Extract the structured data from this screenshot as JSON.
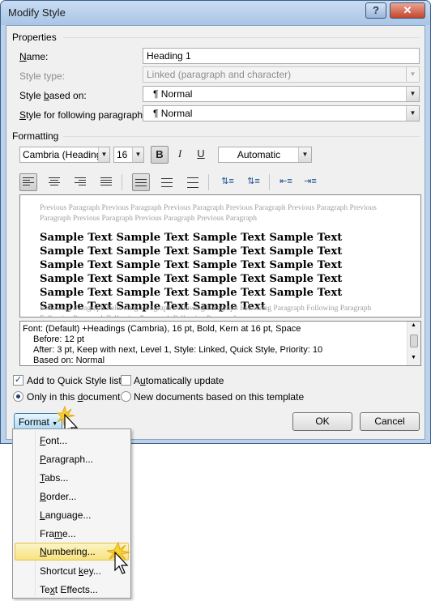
{
  "window": {
    "title": "Modify Style",
    "help_symbol": "?",
    "close_symbol": "x"
  },
  "properties": {
    "section_label": "Properties",
    "name_label": "Name:",
    "name_value": "Heading 1",
    "style_type_label": "Style type:",
    "style_type_value": "Linked (paragraph and character)",
    "based_on_label": "Style based on:",
    "based_on_value": "¶  Normal",
    "following_label": "Style for following paragraph:",
    "following_value": "¶  Normal"
  },
  "formatting": {
    "section_label": "Formatting",
    "font_name": "Cambria (Headings)",
    "font_size": "16",
    "bold_label": "B",
    "italic_label": "I",
    "underline_label": "U",
    "color_value": "Automatic"
  },
  "preview": {
    "previous_paragraph": "Previous Paragraph Previous Paragraph Previous Paragraph Previous Paragraph Previous Paragraph Previous Paragraph Previous Paragraph Previous Paragraph Previous Paragraph",
    "sample_text": "Sample Text Sample Text Sample Text Sample Text Sample Text Sample Text Sample Text Sample Text Sample Text Sample Text Sample Text Sample Text Sample Text Sample Text Sample Text Sample Text Sample Text Sample Text Sample Text Sample Text Sample Text Sample Text Sample Text",
    "following_paragraph": "Following Paragraph Following Paragraph Following Paragraph Following Paragraph Following Paragraph Following Paragraph Following Paragraph Following Paragraph"
  },
  "description": {
    "line1": "Font: (Default) +Headings (Cambria), 16 pt, Bold, Kern at 16 pt, Space",
    "line2": "Before:  12 pt",
    "line3": "After:  3 pt, Keep with next, Level 1, Style: Linked, Quick Style, Priority: 10",
    "line4": "Based on: Normal"
  },
  "options": {
    "quick_style_label": "Add to Quick Style list",
    "quick_style_checked": true,
    "auto_update_label": "Automatically update",
    "auto_update_checked": false,
    "only_doc_label": "Only in this document",
    "new_docs_label": "New documents based on this template",
    "selected_scope": "only_doc"
  },
  "buttons": {
    "format_label": "Format",
    "ok_label": "OK",
    "cancel_label": "Cancel"
  },
  "format_menu": {
    "items": [
      {
        "label": "Font..."
      },
      {
        "label": "Paragraph..."
      },
      {
        "label": "Tabs..."
      },
      {
        "label": "Border..."
      },
      {
        "label": "Language..."
      },
      {
        "label": "Frame..."
      },
      {
        "label": "Numbering..."
      },
      {
        "label": "Shortcut key..."
      },
      {
        "label": "Text Effects..."
      }
    ],
    "highlighted": "Numbering..."
  },
  "colors": {
    "title_bar": "#bcd2ea",
    "menu_highlight": "#f8e27f",
    "format_button": "#a7d9f5"
  }
}
